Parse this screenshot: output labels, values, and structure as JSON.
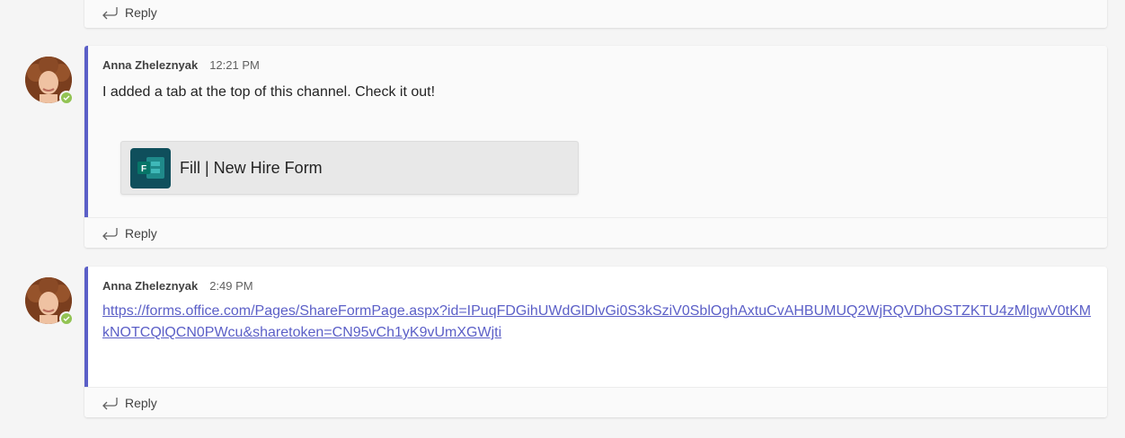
{
  "accent_color": "#5b5fc7",
  "presence_color": "#92c353",
  "reply_label": "Reply",
  "messages": [
    {
      "author": "Anna Zheleznyak",
      "time": "12:21 PM",
      "text": "I added a tab at the top of this channel. Check it out!",
      "tab_card": {
        "label": "Fill | New Hire Form",
        "icon": "forms-icon",
        "icon_letter": "F"
      }
    },
    {
      "author": "Anna Zheleznyak",
      "time": "2:49 PM",
      "link": "https://forms.office.com/Pages/ShareFormPage.aspx?id=IPuqFDGihUWdGlDlvGi0S3kSziV0SblOghAxtuCvAHBUMUQ2WjRQVDhOSTZKTU4zMlgwV0tKMkNOTCQlQCN0PWcu&sharetoken=CN95vCh1yK9vUmXGWjti"
    }
  ]
}
